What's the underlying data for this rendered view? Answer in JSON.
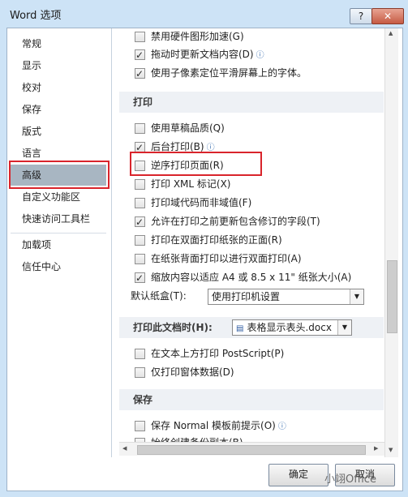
{
  "window": {
    "title": "Word 选项",
    "help_btn": "?",
    "close_btn": "✕"
  },
  "sidebar": {
    "items": [
      {
        "label": "常规"
      },
      {
        "label": "显示"
      },
      {
        "label": "校对"
      },
      {
        "label": "保存"
      },
      {
        "label": "版式"
      },
      {
        "label": "语言"
      },
      {
        "label": "高级"
      },
      {
        "label": "自定义功能区"
      },
      {
        "label": "快速访问工具栏"
      },
      {
        "label": "加载项"
      },
      {
        "label": "信任中心"
      }
    ],
    "selected": "高级"
  },
  "content": {
    "top_options": [
      {
        "label": "禁用硬件图形加速(G)",
        "checked": false
      },
      {
        "label": "拖动时更新文档内容(D)",
        "checked": true,
        "info": true
      },
      {
        "label": "使用子像素定位平滑屏幕上的字体。",
        "checked": true
      }
    ],
    "print_section": {
      "header": "打印",
      "options": [
        {
          "label": "使用草稿品质(Q)",
          "checked": false
        },
        {
          "label": "后台打印(B)",
          "checked": true,
          "info": true
        },
        {
          "label": "逆序打印页面(R)",
          "checked": false
        },
        {
          "label": "打印 XML 标记(X)",
          "checked": false
        },
        {
          "label": "打印域代码而非域值(F)",
          "checked": false
        },
        {
          "label": "允许在打印之前更新包含修订的字段(T)",
          "checked": true
        },
        {
          "label": "打印在双面打印纸张的正面(R)",
          "checked": false
        },
        {
          "label": "在纸张背面打印以进行双面打印(A)",
          "checked": false
        },
        {
          "label": "缩放内容以适应 A4 或 8.5 x 11\" 纸张大小(A)",
          "checked": true
        }
      ],
      "default_tray_label": "默认纸盒(T):",
      "default_tray_value": "使用打印机设置"
    },
    "print_doc_section": {
      "header": "打印此文档时(H):",
      "doc_value": "表格显示表头.docx",
      "options": [
        {
          "label": "在文本上方打印 PostScript(P)",
          "checked": false
        },
        {
          "label": "仅打印窗体数据(D)",
          "checked": false
        }
      ]
    },
    "save_section": {
      "header": "保存",
      "options": [
        {
          "label": "保存 Normal 模板前提示(O)",
          "checked": false,
          "info": true
        },
        {
          "label": "始终创建备份副本(B)",
          "checked": false
        }
      ]
    }
  },
  "buttons": {
    "ok": "确定",
    "cancel": "取消"
  },
  "watermark": "小翊Office"
}
